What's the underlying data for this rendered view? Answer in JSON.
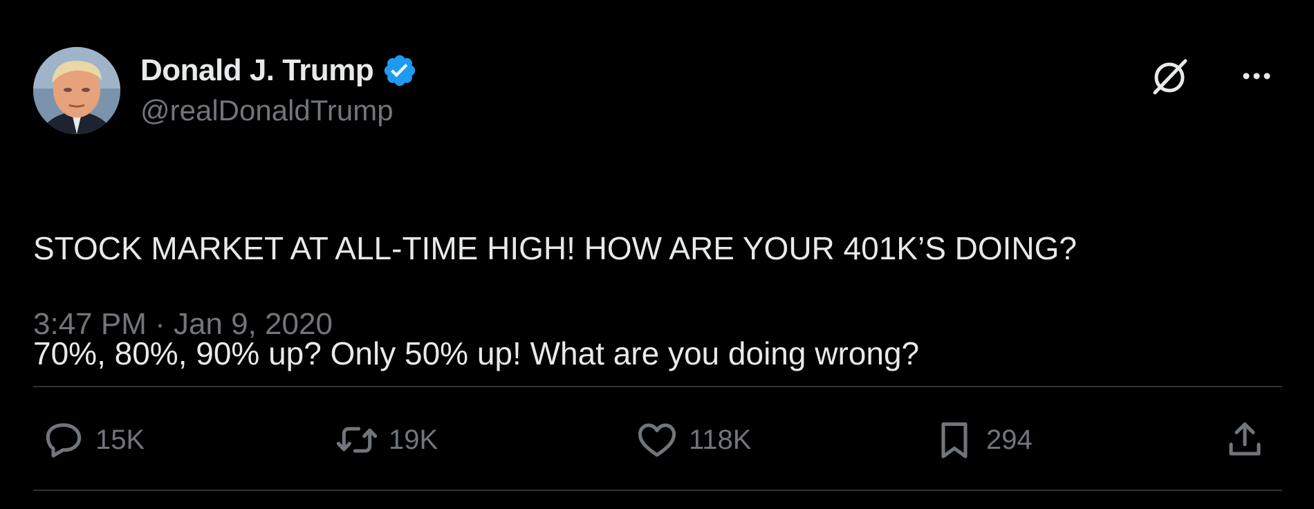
{
  "author": {
    "display_name": "Donald J. Trump",
    "handle": "@realDonaldTrump",
    "verified": true,
    "avatar": "profile-photo"
  },
  "tweet": {
    "text_line_1": "STOCK MARKET AT ALL-TIME HIGH! HOW ARE YOUR 401K’S DOING?",
    "text_line_2": "70%, 80%, 90% up? Only 50% up! What are you doing wrong?",
    "timestamp": "3:47 PM · Jan 9, 2020"
  },
  "actions": {
    "reply": {
      "icon": "reply-icon",
      "count": "15K"
    },
    "retweet": {
      "icon": "retweet-icon",
      "count": "19K"
    },
    "like": {
      "icon": "heart-icon",
      "count": "118K"
    },
    "bookmark": {
      "icon": "bookmark-icon",
      "count": "294"
    },
    "share": {
      "icon": "share-icon"
    }
  },
  "header_icons": {
    "grok": "grok-icon",
    "more": "more-options-icon"
  },
  "colors": {
    "background": "#000000",
    "primary_text": "#e7e9ea",
    "secondary_text": "#71767b",
    "divider": "#2f3336",
    "verified_badge": "#1d9bf0"
  }
}
